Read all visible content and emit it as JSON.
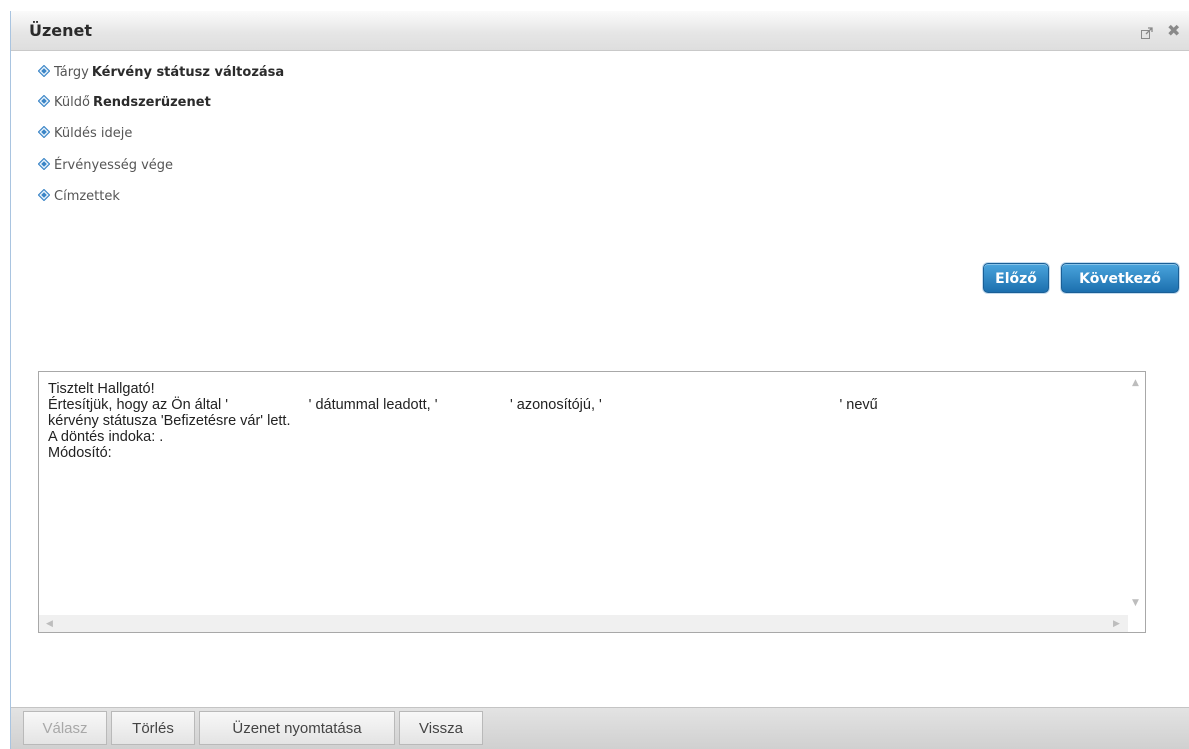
{
  "dialog": {
    "title": "Üzenet"
  },
  "fields": [
    {
      "label": "Tárgy",
      "value": "Kérvény státusz változása"
    },
    {
      "label": "Küldő",
      "value": "Rendszerüzenet"
    },
    {
      "label": "Küldés ideje",
      "value": ""
    },
    {
      "label": "Érvényesség vége",
      "value": ""
    },
    {
      "label": "Címzettek",
      "value": ""
    }
  ],
  "nav": {
    "prev_label": "Előző",
    "next_label": "Következő"
  },
  "message": {
    "line1": "Tisztelt Hallgató!",
    "line2": "Értesítjük, hogy az Ön által '                    ' dátummal leadott, '                  ' azonosítójú, '                                                           ' nevű",
    "line3": "kérvény státusza 'Befizetésre vár' lett.",
    "line4": "A döntés indoka: .",
    "line5": "Módosító:"
  },
  "footer": {
    "reply_label": "Válasz",
    "delete_label": "Törlés",
    "print_label": "Üzenet nyomtatása",
    "back_label": "Vissza"
  },
  "colors": {
    "accent": "#1c6fae",
    "dialog_border": "#a9c4e0"
  }
}
